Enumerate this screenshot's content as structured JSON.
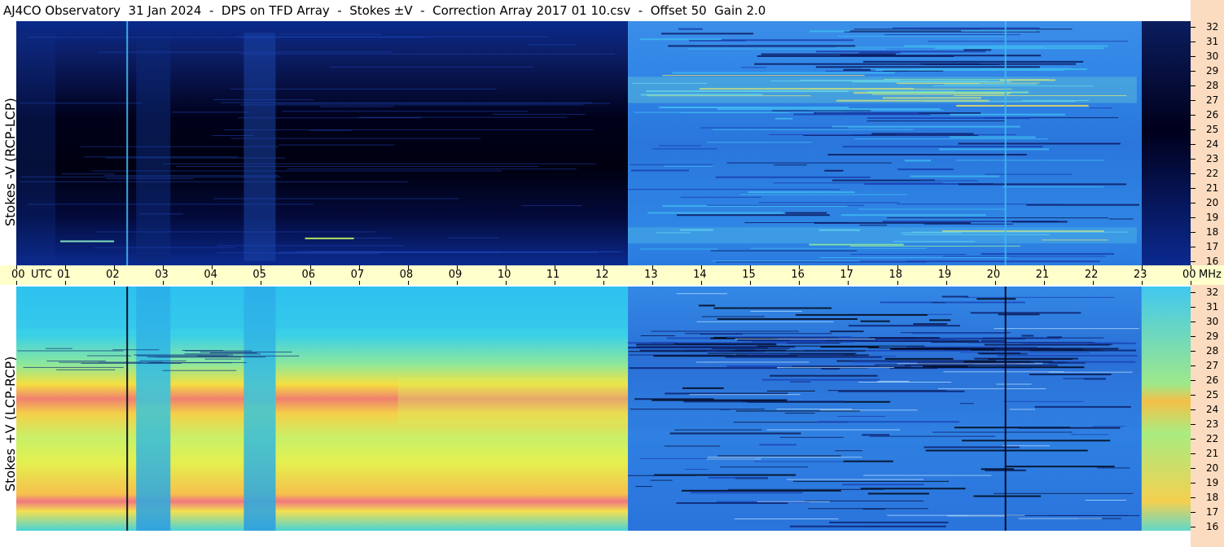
{
  "title": "AJ4CO Observatory  31 Jan 2024  -  DPS on TFD Array  -  Stokes ±V  -  Correction Array 2017 01 10.csv  -  Offset 50  Gain 2.0",
  "time_axis": {
    "utc_label": "UTC",
    "mhz_label": "MHz",
    "ticks": [
      "00",
      "01",
      "02",
      "03",
      "04",
      "05",
      "06",
      "07",
      "08",
      "09",
      "10",
      "11",
      "12",
      "13",
      "14",
      "15",
      "16",
      "17",
      "18",
      "19",
      "20",
      "21",
      "22",
      "23",
      "00"
    ]
  },
  "freq_ticks": [
    "32",
    "31",
    "30",
    "29",
    "28",
    "27",
    "26",
    "25",
    "24",
    "23",
    "22",
    "21",
    "20",
    "19",
    "18",
    "17",
    "16"
  ],
  "colors": {
    "background": "#ffffff",
    "axis_band": "#ffffcc",
    "freq_band": "#fcdcc0"
  },
  "chart_data": [
    {
      "type": "heatmap",
      "title": "Stokes -V (RCP-LCP)",
      "xlabel": "UTC",
      "ylabel": "Stokes -V (RCP-LCP)",
      "x_range_hours": [
        0,
        24
      ],
      "y_range_mhz": [
        16,
        32
      ],
      "colormap": "jet",
      "regions": [
        {
          "start_h": 0.0,
          "end_h": 12.5,
          "level": "very low (black / dark navy)"
        },
        {
          "start_h": 12.5,
          "end_h": 23.0,
          "level": "low-moderate (blue), bright bursts near 27-28 MHz and 17-18 MHz"
        },
        {
          "start_h": 23.0,
          "end_h": 24.0,
          "level": "low (dark blue)"
        }
      ],
      "spikes_utc": [
        2.25,
        20.2
      ]
    },
    {
      "type": "heatmap",
      "title": "Stokes +V (LCP-RCP)",
      "xlabel": "UTC",
      "ylabel": "Stokes +V (LCP-RCP)",
      "x_range_hours": [
        0,
        24
      ],
      "y_range_mhz": [
        16,
        32
      ],
      "colormap": "jet",
      "regions": [
        {
          "start_h": 0.0,
          "end_h": 12.5,
          "level": "high (cyan to yellow, red-pink bands near 24-25 MHz and 17-18 MHz)"
        },
        {
          "start_h": 12.5,
          "end_h": 23.0,
          "level": "low-moderate (blue) with dark streaks near 27-29 MHz"
        },
        {
          "start_h": 23.0,
          "end_h": 24.0,
          "level": "moderate (cyan / yellow)"
        }
      ],
      "spikes_utc": [
        2.25,
        20.2
      ]
    }
  ]
}
